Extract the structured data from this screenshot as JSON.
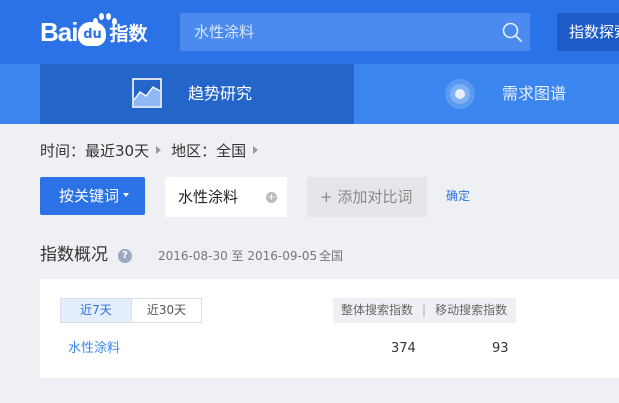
{
  "header": {
    "logo_bai": "Bai",
    "logo_du": "du",
    "logo_zhishu": "指数",
    "search_value": "水性涂料",
    "explore_label": "指数探索"
  },
  "nav": {
    "trend_label": "趋势研究",
    "demand_label": "需求图谱"
  },
  "breadcrumb": {
    "time": "时间：最近30天",
    "region": "地区：全国"
  },
  "keyword_bar": {
    "by_keyword_label": "按关键词",
    "keyword": "水性涂料",
    "add_compare_label": "+ 添加对比词",
    "confirm_label": "确定"
  },
  "overview": {
    "title": "指数概况",
    "date_range": "2016-08-30 至 2016-09-05",
    "region": "全国",
    "tabs": [
      "近7天",
      "近30天"
    ],
    "col_overall": "整体搜索指数",
    "col_sep": "|",
    "col_mobile": "移动搜索指数",
    "rows": [
      {
        "keyword": "水性涂料",
        "overall": "374",
        "mobile": "93"
      }
    ]
  },
  "colors": {
    "topbar": "#2a72e6",
    "navbar": "#3a86ee",
    "nav_active": "#2465c9",
    "accent": "#2a72e6"
  }
}
